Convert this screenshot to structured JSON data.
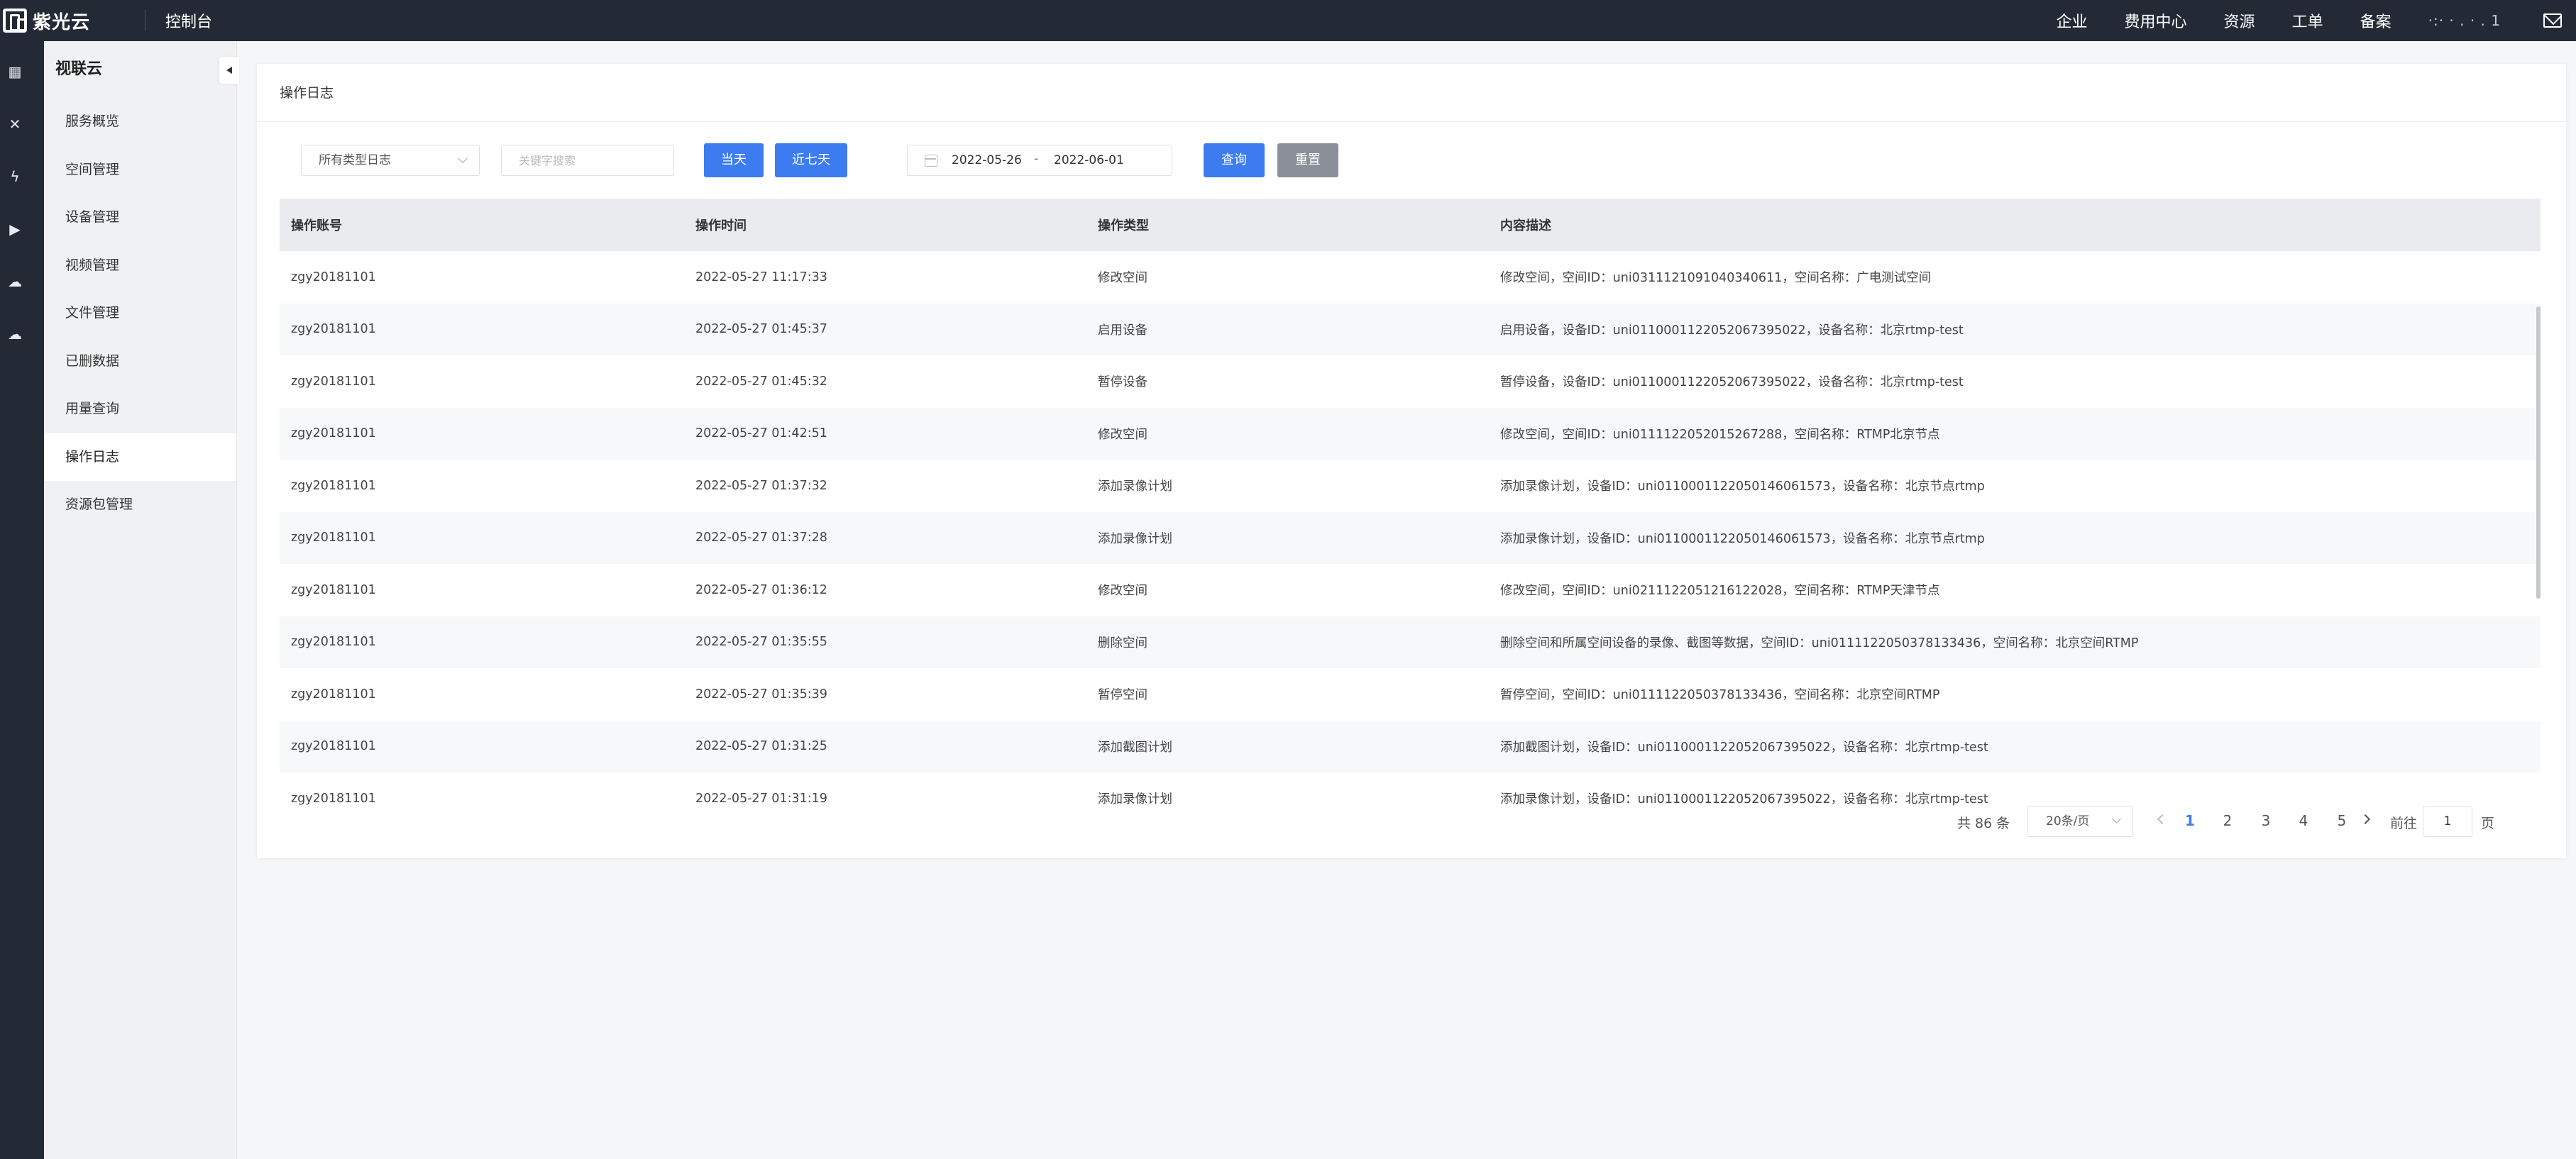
{
  "topbar": {
    "brand": "紫光云",
    "console": "控制台",
    "links": [
      "企业",
      "费用中心",
      "资源",
      "工单",
      "备案"
    ],
    "user": "·:·  · . · . 1"
  },
  "rail": {
    "icons": [
      "grid-icon",
      "network-icon",
      "lightning-icon",
      "video-icon",
      "cloud-icon",
      "cloud-upload-icon"
    ]
  },
  "sidebar": {
    "title": "视联云",
    "items": [
      {
        "label": "服务概览",
        "active": false
      },
      {
        "label": "空间管理",
        "active": false
      },
      {
        "label": "设备管理",
        "active": false
      },
      {
        "label": "视频管理",
        "active": false
      },
      {
        "label": "文件管理",
        "active": false
      },
      {
        "label": "已删数据",
        "active": false
      },
      {
        "label": "用量查询",
        "active": false
      },
      {
        "label": "操作日志",
        "active": true
      },
      {
        "label": "资源包管理",
        "active": false
      }
    ]
  },
  "page": {
    "title": "操作日志"
  },
  "filters": {
    "type_select": "所有类型日志",
    "keyword_placeholder": "关键字搜索",
    "today_label": "当天",
    "week_label": "近七天",
    "date_start": "2022-05-26",
    "date_sep": "-",
    "date_end": "2022-06-01",
    "query_label": "查询",
    "reset_label": "重置"
  },
  "table": {
    "headers": [
      "操作账号",
      "操作时间",
      "操作类型",
      "内容描述"
    ],
    "rows": [
      [
        "zgy20181101",
        "2022-05-27 11:17:33",
        "修改空间",
        "修改空间，空间ID：uni0311121091040340611，空间名称：广电测试空间"
      ],
      [
        "zgy20181101",
        "2022-05-27 01:45:37",
        "启用设备",
        "启用设备，设备ID：uni01100011220520673950​22，设备名称：北京rtmp-test"
      ],
      [
        "zgy20181101",
        "2022-05-27 01:45:32",
        "暂停设备",
        "暂停设备，设备ID：uni0110001122052067395022，设备名称：北京rtmp-test"
      ],
      [
        "zgy20181101",
        "2022-05-27 01:42:51",
        "修改空间",
        "修改空间，空间ID：uni0111122052015267288，空间名称：RTMP北京节点"
      ],
      [
        "zgy20181101",
        "2022-05-27 01:37:32",
        "添加录像计划",
        "添加录像计划，设备ID：uni0110001122050146061573，设备名称：北京节点rtmp"
      ],
      [
        "zgy20181101",
        "2022-05-27 01:37:28",
        "添加录像计划",
        "添加录像计划，设备ID：uni0110001122050146061573，设备名称：北京节点rtmp"
      ],
      [
        "zgy20181101",
        "2022-05-27 01:36:12",
        "修改空间",
        "修改空间，空间ID：uni0211122051216122028，空间名称：RTMP天津节点"
      ],
      [
        "zgy20181101",
        "2022-05-27 01:35:55",
        "删除空间",
        "删除空间和所属空间设备的录像、截图等数据，空间ID：uni0111122050378133436，空间名称：北京空间RTMP"
      ],
      [
        "zgy20181101",
        "2022-05-27 01:35:39",
        "暂停空间",
        "暂停空间，空间ID：uni0111122050378133436，空间名称：北京空间RTMP"
      ],
      [
        "zgy20181101",
        "2022-05-27 01:31:25",
        "添加截图计划",
        "添加截图计划，设备ID：uni0110001122052067395022，设备名称：北京rtmp-test"
      ],
      [
        "zgy20181101",
        "2022-05-27 01:31:19",
        "添加录像计划",
        "添加录像计划，设备ID：uni0110001122052067395022，设备名称：北京rtmp-test"
      ]
    ]
  },
  "pager": {
    "total": "共 86 条",
    "page_size": "20条/页",
    "pages": [
      "1",
      "2",
      "3",
      "4",
      "5"
    ],
    "current": "1",
    "goto_label": "前往",
    "goto_value": "1",
    "goto_suffix": "页"
  }
}
